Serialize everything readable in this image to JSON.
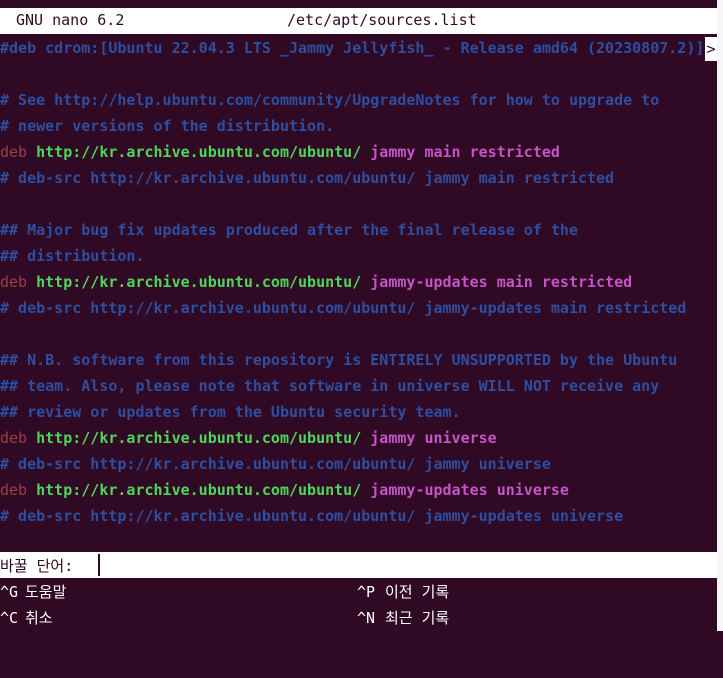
{
  "titlebar": {
    "app": "GNU nano 6.2",
    "filename": "/etc/apt/sources.list"
  },
  "lines": [
    {
      "segments": [
        {
          "text": "#deb cdrom:[Ubuntu 22.04.3 LTS _Jammy Jellyfish_ - Release amd64 (20230807.2)]",
          "cls": "c-comment"
        }
      ],
      "cut_marker": ">"
    },
    {
      "segments": []
    },
    {
      "segments": [
        {
          "text": "# See http://help.ubuntu.com/community/UpgradeNotes for how to upgrade to",
          "cls": "c-comment"
        }
      ]
    },
    {
      "segments": [
        {
          "text": "# newer versions of the distribution.",
          "cls": "c-comment"
        }
      ]
    },
    {
      "segments": [
        {
          "text": "deb ",
          "cls": "c-deb"
        },
        {
          "text": "http://kr.archive.ubuntu.com/ubuntu/ ",
          "cls": "c-url"
        },
        {
          "text": "jammy main restricted",
          "cls": "c-kw"
        }
      ]
    },
    {
      "segments": [
        {
          "text": "# deb-src http://kr.archive.ubuntu.com/ubuntu/ jammy main restricted",
          "cls": "c-comment"
        }
      ]
    },
    {
      "segments": []
    },
    {
      "segments": [
        {
          "text": "## Major bug fix updates produced after the final release of the",
          "cls": "c-comment"
        }
      ]
    },
    {
      "segments": [
        {
          "text": "## distribution.",
          "cls": "c-comment"
        }
      ]
    },
    {
      "segments": [
        {
          "text": "deb ",
          "cls": "c-deb"
        },
        {
          "text": "http://kr.archive.ubuntu.com/ubuntu/ ",
          "cls": "c-url"
        },
        {
          "text": "jammy-updates main restricted",
          "cls": "c-kw"
        }
      ]
    },
    {
      "segments": [
        {
          "text": "# deb-src http://kr.archive.ubuntu.com/ubuntu/ jammy-updates main restricted",
          "cls": "c-comment"
        }
      ]
    },
    {
      "segments": []
    },
    {
      "segments": [
        {
          "text": "## N.B. software from this repository is ENTIRELY UNSUPPORTED by the Ubuntu",
          "cls": "c-comment"
        }
      ]
    },
    {
      "segments": [
        {
          "text": "## team. Also, please note that software in universe WILL NOT receive any",
          "cls": "c-comment"
        }
      ]
    },
    {
      "segments": [
        {
          "text": "## review or updates from the Ubuntu security team.",
          "cls": "c-comment"
        }
      ]
    },
    {
      "segments": [
        {
          "text": "deb ",
          "cls": "c-deb"
        },
        {
          "text": "http://kr.archive.ubuntu.com/ubuntu/ ",
          "cls": "c-url"
        },
        {
          "text": "jammy universe",
          "cls": "c-kw"
        }
      ]
    },
    {
      "segments": [
        {
          "text": "# deb-src http://kr.archive.ubuntu.com/ubuntu/ jammy universe",
          "cls": "c-comment"
        }
      ]
    },
    {
      "segments": [
        {
          "text": "deb ",
          "cls": "c-deb"
        },
        {
          "text": "http://kr.archive.ubuntu.com/ubuntu/ ",
          "cls": "c-url"
        },
        {
          "text": "jammy-updates universe",
          "cls": "c-kw"
        }
      ]
    },
    {
      "segments": [
        {
          "text": "# deb-src http://kr.archive.ubuntu.com/ubuntu/ jammy-updates universe",
          "cls": "c-comment"
        }
      ]
    }
  ],
  "prompt": {
    "label": "바꿀 단어:",
    "value": ""
  },
  "shortcuts": [
    {
      "key": "^G",
      "label": "도움말"
    },
    {
      "key": "^P",
      "label": "이전 기록"
    },
    {
      "key": "^C",
      "label": "취소"
    },
    {
      "key": "^N",
      "label": "최근 기록"
    }
  ],
  "colors": {
    "background": "#300a24",
    "comment": "#2d4ea1",
    "url": "#4fd65a",
    "keyword": "#c454c8",
    "deb": "#a33b46",
    "bar": "#ffffff"
  }
}
